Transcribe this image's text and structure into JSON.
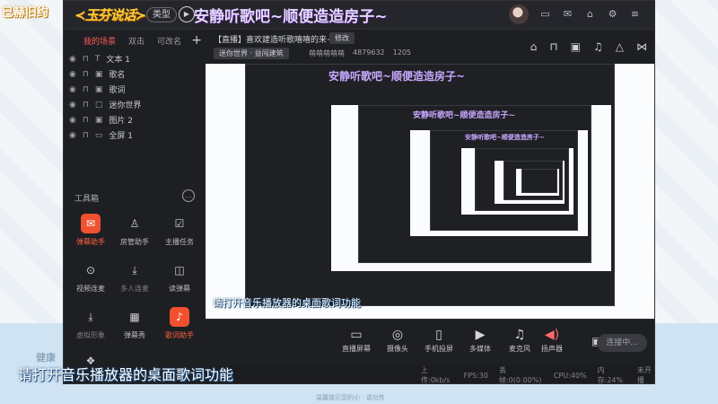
{
  "overlay": {
    "top_left": "已赫旧约",
    "title": "安静听歌吧~顺便造造房子~",
    "lyric": "请打开音乐播放器的桌面歌词功能",
    "left_watermark": "健康",
    "bottom_caption": "温馨提示您的小 · 请勿传"
  },
  "app": {
    "logo": "≺玉芬说话≻",
    "type_button": "类型",
    "top_icons": [
      "message-icon",
      "mail-icon",
      "shirt-icon",
      "settings-icon",
      "menu-icon",
      "minimize-icon",
      "close-icon"
    ]
  },
  "scene_panel": {
    "tabs": [
      "我的场景",
      "双击",
      "可改名"
    ],
    "add": "+",
    "sources": [
      {
        "label": "文本 1",
        "icon": "text-source-icon"
      },
      {
        "label": "歌名",
        "icon": "image-source-icon"
      },
      {
        "label": "歌词",
        "icon": "image-source-icon"
      },
      {
        "label": "迷你世界",
        "icon": "window-source-icon"
      },
      {
        "label": "图片 2",
        "icon": "image-source-icon"
      },
      {
        "label": "全屏 1",
        "icon": "display-source-icon"
      }
    ]
  },
  "toolbox": {
    "title": "工具箱",
    "tools": [
      {
        "label": "弹幕助手",
        "icon": "danmaku-helper-icon",
        "highlight": true
      },
      {
        "label": "房管助手",
        "icon": "room-admin-icon",
        "highlight": false
      },
      {
        "label": "主播任务",
        "icon": "streamer-task-icon",
        "highlight": false
      },
      {
        "label": "视频连麦",
        "icon": "video-mic-icon",
        "highlight": false
      },
      {
        "label": "多人连麦",
        "icon": "multi-mic-icon",
        "highlight": false
      },
      {
        "label": "读弹幕",
        "icon": "read-danmaku-icon",
        "highlight": false
      },
      {
        "label": "虚拟形象",
        "icon": "avatar-download-icon",
        "highlight": false
      },
      {
        "label": "弹幕秀",
        "icon": "danmaku-show-icon",
        "highlight": false
      },
      {
        "label": "歌词助手",
        "icon": "lyrics-helper-icon",
        "highlight": true
      }
    ]
  },
  "stream": {
    "title": "【直播】喜欢建造听歌嘻嘻的来~",
    "modify_button": "修改",
    "category": "迷你世界 · 益闯建筑",
    "owner": "萌萌萌萌萌",
    "room_id": "4879632",
    "heat": "1205",
    "right_icons": [
      "store-icon",
      "lock-icon",
      "bag-icon",
      "bell-icon",
      "bell-icon",
      "share-icon"
    ]
  },
  "bottom_bar": {
    "buttons": [
      {
        "label": "直播屏幕",
        "icon": "screen-share-icon"
      },
      {
        "label": "摄像头",
        "icon": "camera-icon"
      },
      {
        "label": "手机投屏",
        "icon": "phone-cast-icon"
      },
      {
        "label": "多媒体",
        "icon": "media-icon"
      },
      {
        "label": "麦克风",
        "icon": "microphone-icon"
      },
      {
        "label": "扬声器",
        "icon": "speaker-icon"
      }
    ],
    "live_button": "连接中..."
  },
  "status": {
    "upload": "上传:0kb/s",
    "fps": "FPS:30",
    "dropped": "丢帧:0(0.00%)",
    "cpu": "CPU:40%",
    "memory": "内存:24%",
    "unlive": "未开播"
  },
  "preview": {
    "nested_title": "安静听歌吧~顺便造造房子~",
    "nested_lyric": "请打开音乐播放器的桌面歌词功能"
  }
}
